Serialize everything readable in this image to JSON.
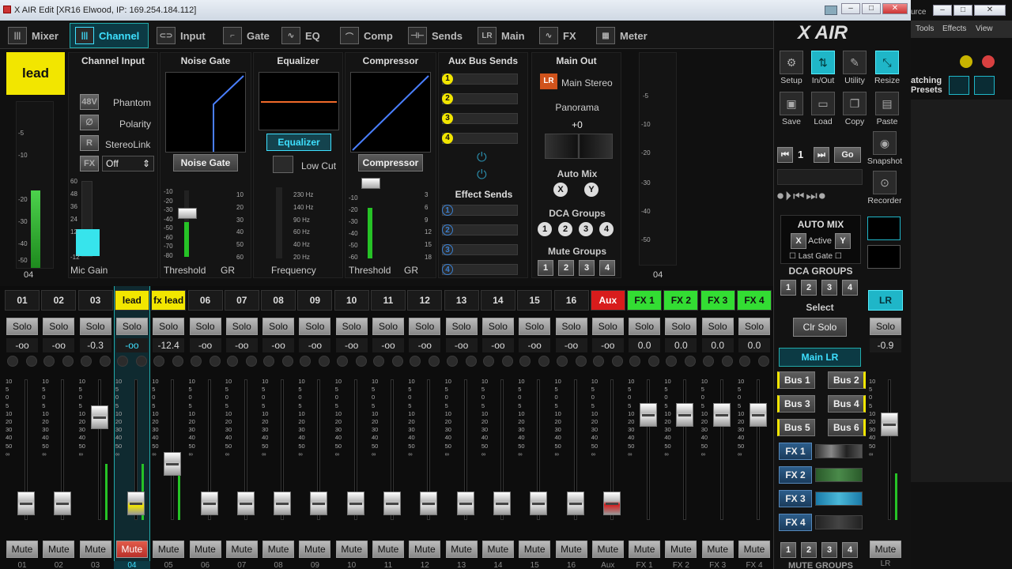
{
  "window": {
    "title": "X AIR Edit [XR16 Elwood, IP: 169.254.184.112]",
    "bg_fragment": "urce"
  },
  "nav": {
    "tabs": [
      {
        "label": "Mixer",
        "icon": "mixer-icon"
      },
      {
        "label": "Channel",
        "icon": "channel-icon",
        "active": true
      },
      {
        "label": "Input",
        "icon": "input-icon"
      },
      {
        "label": "Gate",
        "icon": "gate-icon"
      },
      {
        "label": "EQ",
        "icon": "eq-icon"
      },
      {
        "label": "Comp",
        "icon": "comp-icon"
      },
      {
        "label": "Sends",
        "icon": "sends-icon"
      },
      {
        "label": "Main",
        "icon": "main-icon"
      },
      {
        "label": "FX",
        "icon": "fx-icon"
      },
      {
        "label": "Meter",
        "icon": "meter-icon"
      }
    ]
  },
  "channel": {
    "name": "lead",
    "number": "04",
    "name_color": "#f2e600",
    "meter_scale": [
      "-5",
      "-10",
      "-20",
      "-30",
      "-40",
      "-50"
    ],
    "input": {
      "title": "Channel Input",
      "phantom_label": "Phantom",
      "phantom_btn": "48V",
      "polarity_label": "Polarity",
      "polarity_btn": "∅",
      "stereo_label": "StereoLink",
      "stereo_btn": "R",
      "fx_btn": "FX",
      "fx_value": "Off",
      "gain_label": "Mic Gain",
      "gain_scale": [
        "60",
        "48",
        "36",
        "24",
        "12",
        "-12"
      ],
      "gain_level": 0.35
    },
    "gate": {
      "title": "Noise Gate",
      "button": "Noise Gate",
      "threshold_label": "Threshold",
      "gr_label": "GR",
      "scale_left": [
        "-10",
        "-20",
        "-30",
        "-40",
        "-50",
        "-60",
        "-70",
        "-80"
      ],
      "scale_right": [
        "10",
        "20",
        "30",
        "40",
        "50",
        "60"
      ]
    },
    "eq": {
      "title": "Equalizer",
      "button": "Equalizer",
      "lowcut_label": "Low Cut",
      "freq_label": "Frequency",
      "freqs": [
        "230 Hz",
        "140 Hz",
        "90 Hz",
        "60 Hz",
        "40 Hz",
        "20 Hz"
      ]
    },
    "comp": {
      "title": "Compressor",
      "button": "Compressor",
      "threshold_label": "Threshold",
      "gr_label": "GR",
      "scale_left": [
        "-10",
        "-20",
        "-30",
        "-40",
        "-50",
        "-60"
      ],
      "scale_right": [
        "3",
        "6",
        "9",
        "12",
        "15",
        "18"
      ]
    },
    "aux": {
      "title": "Aux Bus Sends",
      "sends": [
        "1",
        "2",
        "3",
        "4"
      ],
      "effect_title": "Effect Sends",
      "effects": [
        "1",
        "2",
        "3",
        "4"
      ]
    },
    "main": {
      "title": "Main Out",
      "lr_btn": "LR",
      "main_stereo": "Main Stereo",
      "panorama_label": "Panorama",
      "pan_value": "+0",
      "automix_label": "Auto Mix",
      "automix_x": "X",
      "automix_y": "Y",
      "dca_label": "DCA Groups",
      "dca": [
        "1",
        "2",
        "3",
        "4"
      ],
      "mute_label": "Mute Groups",
      "mute": [
        "1",
        "2",
        "3",
        "4"
      ]
    },
    "fader_number": "04"
  },
  "strips": [
    {
      "name": "01",
      "value": "-oo",
      "bottom": "01",
      "fader": 0.12,
      "meter": 0
    },
    {
      "name": "02",
      "value": "-oo",
      "bottom": "02",
      "fader": 0.12,
      "meter": 0
    },
    {
      "name": "03",
      "value": "-0.3",
      "bottom": "03",
      "fader": 0.73,
      "meter": 0.4
    },
    {
      "name": "lead",
      "value": "-oo",
      "bottom": "04",
      "fader": 0.12,
      "meter": 0.4,
      "highlight": "#f2e600",
      "selected": true,
      "muted": true
    },
    {
      "name": "fx lead",
      "value": "-12.4",
      "bottom": "05",
      "fader": 0.4,
      "meter": 0.35,
      "highlight": "#f2e600"
    },
    {
      "name": "06",
      "value": "-oo",
      "bottom": "06",
      "fader": 0.12,
      "meter": 0
    },
    {
      "name": "07",
      "value": "-oo",
      "bottom": "07",
      "fader": 0.12,
      "meter": 0
    },
    {
      "name": "08",
      "value": "-oo",
      "bottom": "08",
      "fader": 0.12,
      "meter": 0
    },
    {
      "name": "09",
      "value": "-oo",
      "bottom": "09",
      "fader": 0.12,
      "meter": 0
    },
    {
      "name": "10",
      "value": "-oo",
      "bottom": "10",
      "fader": 0.12,
      "meter": 0
    },
    {
      "name": "11",
      "value": "-oo",
      "bottom": "11",
      "fader": 0.12,
      "meter": 0
    },
    {
      "name": "12",
      "value": "-oo",
      "bottom": "12",
      "fader": 0.12,
      "meter": 0
    },
    {
      "name": "13",
      "value": "-oo",
      "bottom": "13",
      "fader": 0.12,
      "meter": 0
    },
    {
      "name": "14",
      "value": "-oo",
      "bottom": "14",
      "fader": 0.12,
      "meter": 0
    },
    {
      "name": "15",
      "value": "-oo",
      "bottom": "15",
      "fader": 0.12,
      "meter": 0
    },
    {
      "name": "16",
      "value": "-oo",
      "bottom": "16",
      "fader": 0.12,
      "meter": 0
    },
    {
      "name": "Aux",
      "value": "-oo",
      "bottom": "Aux",
      "fader": 0.12,
      "meter": 0,
      "highlight": "#d81c1c",
      "redcap": true
    },
    {
      "name": "FX 1",
      "value": "0.0",
      "bottom": "FX 1",
      "fader": 0.75,
      "meter": 0,
      "highlight": "#33dd33"
    },
    {
      "name": "FX 2",
      "value": "0.0",
      "bottom": "FX 2",
      "fader": 0.75,
      "meter": 0,
      "highlight": "#33dd33"
    },
    {
      "name": "FX 3",
      "value": "0.0",
      "bottom": "FX 3",
      "fader": 0.75,
      "meter": 0,
      "highlight": "#33dd33"
    },
    {
      "name": "FX 4",
      "value": "0.0",
      "bottom": "FX 4",
      "fader": 0.75,
      "meter": 0,
      "highlight": "#33dd33"
    }
  ],
  "solo_label": "Solo",
  "mute_label": "Mute",
  "fader_scale": [
    "10",
    "5",
    "0",
    "5",
    "10",
    "20",
    "30",
    "40",
    "50",
    "∞"
  ],
  "right": {
    "logo": "X AIR",
    "tools": [
      {
        "label": "Setup",
        "icon": "gear-icon"
      },
      {
        "label": "In/Out",
        "icon": "in-out-icon",
        "active": true
      },
      {
        "label": "Utility",
        "icon": "wrench-icon"
      },
      {
        "label": "Resize",
        "icon": "resize-icon",
        "active": true
      }
    ],
    "files": [
      {
        "label": "Save",
        "icon": "save-icon"
      },
      {
        "label": "Load",
        "icon": "folder-icon"
      },
      {
        "label": "Copy",
        "icon": "copy-icon"
      },
      {
        "label": "Paste",
        "icon": "paste-icon"
      }
    ],
    "snapshot_num": "1",
    "go_label": "Go",
    "snapshot_label": "Snapshot",
    "recorder_label": "Recorder",
    "automix": {
      "title": "AUTO MIX",
      "x": "X",
      "active": "Active",
      "y": "Y",
      "last_gate": "Last Gate"
    },
    "dca_title": "DCA GROUPS",
    "dca": [
      "1",
      "2",
      "3",
      "4"
    ],
    "select_label": "Select",
    "clr_solo": "Clr Solo",
    "main_lr": "Main LR",
    "buses": [
      "Bus 1",
      "Bus 2",
      "Bus 3",
      "Bus 4",
      "Bus 5",
      "Bus 6"
    ],
    "fx": [
      "FX 1",
      "FX 2",
      "FX 3",
      "FX 4"
    ],
    "mute_groups": [
      "1",
      "2",
      "3",
      "4"
    ],
    "mute_groups_title": "MUTE GROUPS",
    "lr": {
      "name": "LR",
      "value": "-0.9",
      "solo": "Solo",
      "mute": "Mute",
      "bottom": "LR",
      "fader": 0.68,
      "meter": 0.33
    }
  },
  "far": {
    "menu": [
      "Tools",
      "Effects",
      "View"
    ],
    "text1": "atching",
    "text2": "Presets"
  }
}
